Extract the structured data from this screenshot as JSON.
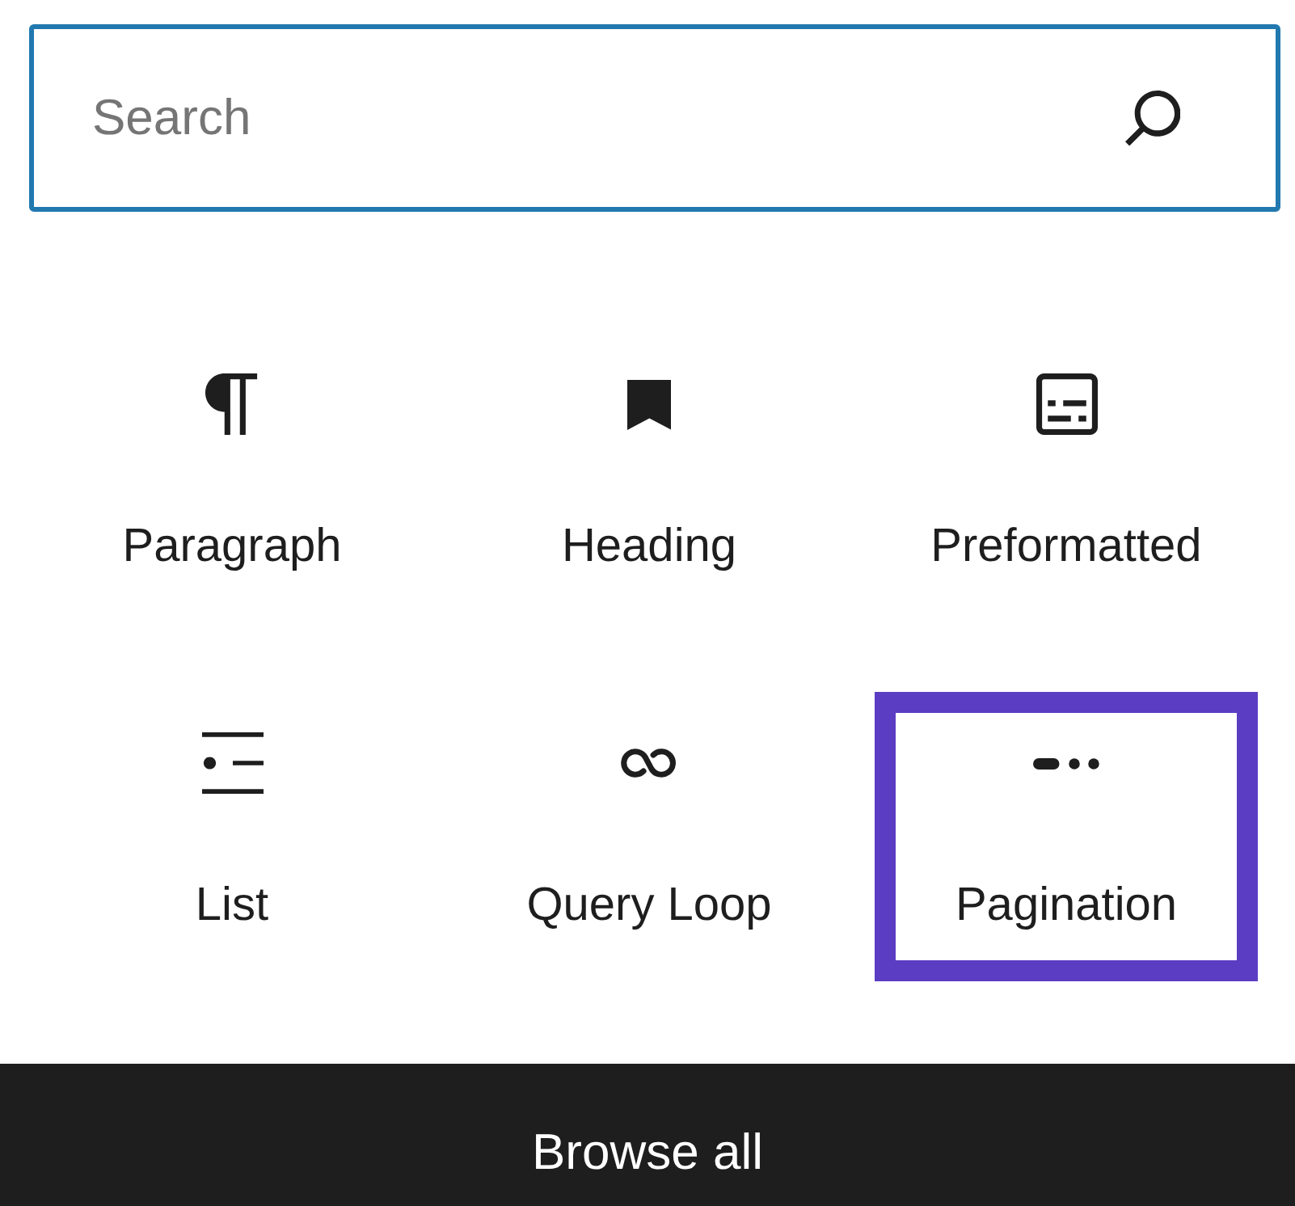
{
  "search": {
    "placeholder": "Search"
  },
  "blocks": [
    {
      "kind": "paragraph",
      "label": "Paragraph",
      "highlighted": false
    },
    {
      "kind": "heading",
      "label": "Heading",
      "highlighted": false
    },
    {
      "kind": "preformatted",
      "label": "Preformatted",
      "highlighted": false
    },
    {
      "kind": "list",
      "label": "List",
      "highlighted": false
    },
    {
      "kind": "loop",
      "label": "Query Loop",
      "highlighted": false
    },
    {
      "kind": "pagination",
      "label": "Pagination",
      "highlighted": true
    }
  ],
  "browse_button": {
    "label": "Browse all"
  }
}
